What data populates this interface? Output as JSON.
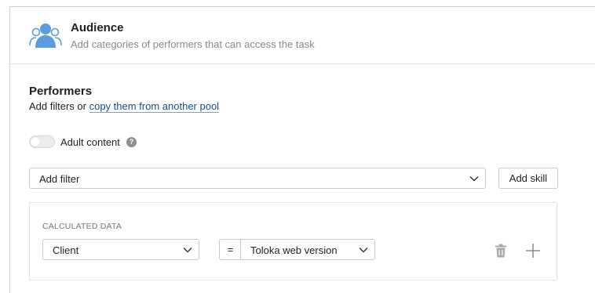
{
  "audience": {
    "title": "Audience",
    "subtitle": "Add categories of performers that can access the task",
    "icon": "users-icon"
  },
  "performers": {
    "title": "Performers",
    "desc_prefix": "Add filters or ",
    "copy_link": "copy them from another pool"
  },
  "adult_content": {
    "label": "Adult content",
    "enabled": false,
    "help_glyph": "?"
  },
  "filter": {
    "placeholder": "Add filter",
    "add_skill_label": "Add skill"
  },
  "calculated": {
    "section_label": "CALCULATED DATA",
    "field": "Client",
    "operator": "=",
    "value": "Toloka web version"
  },
  "colors": {
    "accent_icon": "#4d8fd6",
    "link": "#1a4a8f",
    "border": "#c8c8c8"
  }
}
